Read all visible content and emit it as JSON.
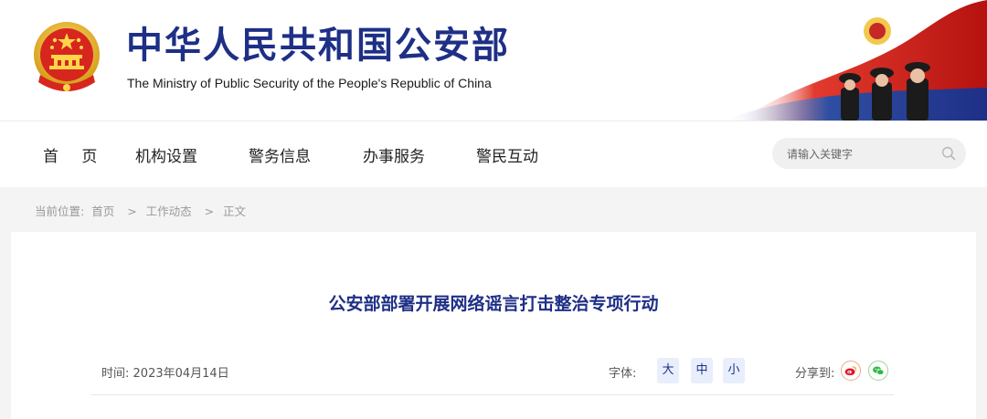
{
  "header": {
    "title": "中华人民共和国公安部",
    "subtitle": "The Ministry of Public Security of the People's Republic of China",
    "brand_color": "#1e2f86",
    "emblem_icon": "national-emblem-icon",
    "banner_art": "police-honor-guard-flag"
  },
  "nav": {
    "items": [
      {
        "label": "首 页"
      },
      {
        "label": "机构设置"
      },
      {
        "label": "警务信息"
      },
      {
        "label": "办事服务"
      },
      {
        "label": "警民互动"
      }
    ]
  },
  "search": {
    "placeholder": "请输入关键字",
    "icon": "search-icon"
  },
  "breadcrumb": {
    "prefix": "当前位置:",
    "items": [
      "首页",
      "工作动态",
      "正文"
    ],
    "separator": ">"
  },
  "article": {
    "title": "公安部部署开展网络谣言打击整治专项行动",
    "date_label": "时间:",
    "date": "2023年04月14日",
    "font_label": "字体:",
    "font_options": [
      "大",
      "中",
      "小"
    ],
    "share_label": "分享到:",
    "share_icons": [
      "weibo-icon",
      "wechat-icon"
    ],
    "accent_color": "#1e2f86"
  }
}
